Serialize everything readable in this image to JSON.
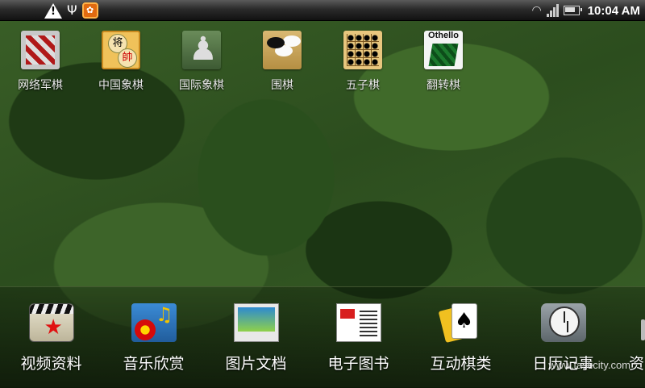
{
  "status_bar": {
    "time": "10:04 AM",
    "icons": [
      "warning-icon",
      "usb-icon",
      "app-notification-icon",
      "wifi-icon",
      "signal-icon",
      "battery-icon"
    ]
  },
  "apps": [
    {
      "label": "网络军棋",
      "icon": "army-chess-icon"
    },
    {
      "label": "中国象棋",
      "icon": "xiangqi-icon"
    },
    {
      "label": "国际象棋",
      "icon": "chess-icon"
    },
    {
      "label": "围棋",
      "icon": "go-icon"
    },
    {
      "label": "五子棋",
      "icon": "gomoku-icon"
    },
    {
      "label": "翻转棋",
      "icon": "othello-icon",
      "icon_text": "Othello"
    }
  ],
  "dock": {
    "items": [
      {
        "label": "视频资料",
        "icon": "video-icon"
      },
      {
        "label": "音乐欣赏",
        "icon": "music-icon"
      },
      {
        "label": "图片文档",
        "icon": "photo-icon"
      },
      {
        "label": "电子图书",
        "icon": "ebook-icon"
      },
      {
        "label": "互动棋类",
        "icon": "cards-icon"
      },
      {
        "label": "日历记事",
        "icon": "calendar-clock-icon"
      }
    ],
    "partial_label": "资"
  },
  "watermark": "www.tasticity.com"
}
